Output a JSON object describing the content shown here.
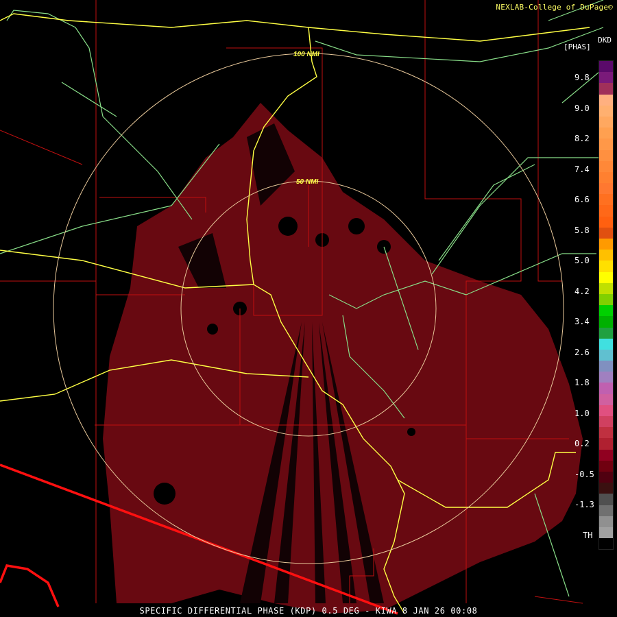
{
  "header": {
    "credit": "NEXLAB-College of DuPage©",
    "product_code": "DKD",
    "units": "[PHAS]"
  },
  "footer": {
    "caption": "SPECIFIC DIFFERENTIAL PHASE (KDP) 0.5 DEG - KIWA 8 JAN 26 00:08"
  },
  "range_rings": {
    "outer_label": "100 NMI",
    "inner_label": "50 NMI"
  },
  "legend": {
    "labels": [
      "9.8",
      "9.0",
      "8.2",
      "7.4",
      "6.6",
      "5.8",
      "5.0",
      "4.2",
      "3.4",
      "2.6",
      "1.8",
      "1.0",
      "0.2",
      "-0.5",
      "-1.3",
      "TH"
    ],
    "colors": [
      "#5a0a6a",
      "#7a1a7a",
      "#a0305a",
      "#ffb080",
      "#ffb070",
      "#ffa860",
      "#ffa050",
      "#ff9848",
      "#ff9040",
      "#ff8838",
      "#ff8030",
      "#ff7830",
      "#ff7020",
      "#ff6818",
      "#ff6010",
      "#e05010",
      "#ff9a00",
      "#ffc000",
      "#ffe000",
      "#ffff00",
      "#c0e000",
      "#80d000",
      "#00d000",
      "#00b000",
      "#20a040",
      "#40e0e0",
      "#60c0d0",
      "#8090c0",
      "#a080c0",
      "#c060b0",
      "#d060a0",
      "#e05080",
      "#d04060",
      "#c03040",
      "#b02030",
      "#900020",
      "#700010",
      "#500010",
      "#3a1010",
      "#505050",
      "#707070",
      "#909090",
      "#a0a0a0",
      "#000000"
    ]
  },
  "map_colors": {
    "echo": "#7a0a14",
    "state_border": "#ff0000",
    "county_border": "#c01010",
    "interstate": "#ffff44",
    "highway": "#88dd88",
    "range_ring": "#e8c89a"
  },
  "symbols": [
    "radar-echo-area",
    "county-lines",
    "state-border",
    "interstate-highways",
    "us-highways",
    "range-rings"
  ]
}
